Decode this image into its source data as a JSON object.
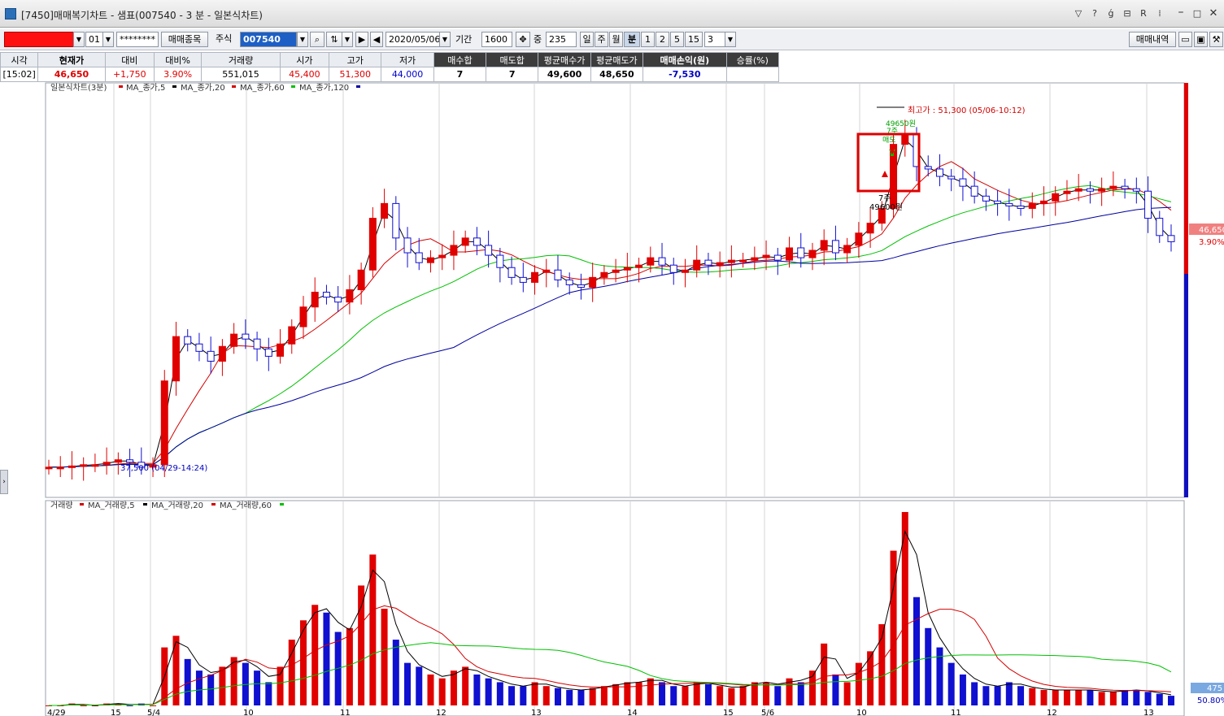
{
  "window": {
    "title": "[7450]매매복기차트 - 샘표(007540 - 3 분 - 일본식차트)",
    "buttons": [
      "▽",
      "?",
      "ǵ",
      "⊟",
      "R",
      "⁞"
    ]
  },
  "toolbar": {
    "account": "",
    "account_sub": "01",
    "password": "********",
    "trade_item_btn": "매매종목",
    "market": "주식",
    "code": "007540",
    "date": "2020/05/06",
    "period_label": "기간",
    "period": "1600",
    "mid_label": "중",
    "mid_value": "235",
    "interval_tabs": [
      "일",
      "주",
      "월",
      "분",
      "1",
      "2",
      "5",
      "15"
    ],
    "interval_value": "3",
    "history_btn": "매매내역"
  },
  "info": {
    "headers": [
      "시각",
      "현재가",
      "대비",
      "대비%",
      "거래량",
      "시가",
      "고가",
      "저가",
      "매수합",
      "매도합",
      "평균매수가",
      "평균매도가",
      "매매손익(원)",
      "승률(%)"
    ],
    "values": [
      "[15:02]",
      "46,650",
      "+1,750",
      "3.90%",
      "551,015",
      "45,400",
      "51,300",
      "44,000",
      "7",
      "7",
      "49,600",
      "48,650",
      "-7,530",
      ""
    ]
  },
  "price_chart": {
    "legend": [
      {
        "text": "일본식차트(3분)",
        "color": "#d40000"
      },
      {
        "text": "MA_종가,5",
        "color": "#000000"
      },
      {
        "text": "MA_종가,20",
        "color": "#d40000"
      },
      {
        "text": "MA_종가,60",
        "color": "#00c000"
      },
      {
        "text": "MA_종가,120",
        "color": "#0000a0"
      }
    ],
    "annotations": {
      "high": "최고가 : 51,300 (05/06-10:12)",
      "low": "37,500 (04/29-14:24)",
      "sell_qty": "7주",
      "sell_price": "49650원",
      "sell_label": "매도",
      "buy_qty": "7주",
      "buy_price": "49600원",
      "current_price": "46,650",
      "current_pct": "3.90%"
    }
  },
  "volume_chart": {
    "legend": [
      {
        "text": "거래량",
        "color": "#d40000"
      },
      {
        "text": "MA_거래량,5",
        "color": "#000000"
      },
      {
        "text": "MA_거래량,20",
        "color": "#d40000"
      },
      {
        "text": "MA_거래량,60",
        "color": "#00c000"
      }
    ],
    "current_volume": "475",
    "current_pct": "50.80%"
  },
  "x_axis": {
    "labels": [
      "4/29",
      "15",
      "5/4",
      "10",
      "11",
      "12",
      "13",
      "14",
      "15",
      "5/6",
      "10",
      "11",
      "12",
      "13"
    ]
  },
  "chart_data": {
    "type": "candlestick",
    "title": "일본식차트(3분)",
    "security": "샘표(007540)",
    "interval": "3 분",
    "price_high": 51300,
    "price_high_time": "05/06-10:12",
    "price_low": 37500,
    "price_low_time": "04/29-14:24",
    "current_price": 46650,
    "change": 1750,
    "change_pct": 3.9,
    "volume": 551015,
    "open": 45400,
    "day_high": 51300,
    "day_low": 44000,
    "trades": [
      {
        "side": "buy",
        "qty": 7,
        "price": 49600
      },
      {
        "side": "sell",
        "qty": 7,
        "price": 49650
      }
    ],
    "ylim": [
      37000,
      52500
    ],
    "close_path": [
      37500,
      37500,
      37550,
      37600,
      37600,
      37700,
      37800,
      37700,
      37500,
      37600,
      41000,
      42800,
      42500,
      42200,
      41800,
      42400,
      42900,
      42700,
      42300,
      42000,
      42500,
      43200,
      44000,
      44600,
      44400,
      44200,
      44700,
      45500,
      47600,
      48200,
      46800,
      46200,
      45800,
      46000,
      46100,
      46500,
      46800,
      46500,
      46100,
      45600,
      45200,
      45000,
      45400,
      45500,
      45100,
      44900,
      44800,
      45200,
      45400,
      45500,
      45600,
      45700,
      46000,
      45700,
      45400,
      45500,
      45900,
      45700,
      45800,
      45900,
      45900,
      46000,
      46100,
      45900,
      46400,
      46000,
      46300,
      46700,
      46200,
      46500,
      47000,
      47400,
      48000,
      50600,
      51000,
      49700,
      49600,
      49300,
      49200,
      48900,
      48500,
      48300,
      48200,
      48100,
      48000,
      48200,
      48300,
      48600,
      48700,
      48800,
      48700,
      48800,
      48900,
      48800,
      48700,
      47600,
      46900,
      46650
    ],
    "volume_path": [
      0,
      0,
      1,
      0,
      0,
      1,
      1,
      0,
      1,
      0,
      30,
      36,
      24,
      18,
      16,
      20,
      25,
      22,
      18,
      12,
      20,
      34,
      44,
      52,
      48,
      38,
      40,
      62,
      78,
      50,
      34,
      22,
      20,
      16,
      14,
      18,
      20,
      16,
      14,
      12,
      10,
      10,
      12,
      10,
      9,
      8,
      8,
      9,
      10,
      11,
      12,
      12,
      14,
      12,
      10,
      10,
      12,
      11,
      10,
      9,
      10,
      12,
      12,
      10,
      14,
      12,
      18,
      32,
      16,
      12,
      22,
      28,
      42,
      80,
      100,
      56,
      40,
      30,
      22,
      16,
      12,
      10,
      10,
      12,
      10,
      9,
      8,
      8,
      8,
      8,
      8,
      7,
      7,
      8,
      8,
      7,
      6,
      5
    ]
  }
}
